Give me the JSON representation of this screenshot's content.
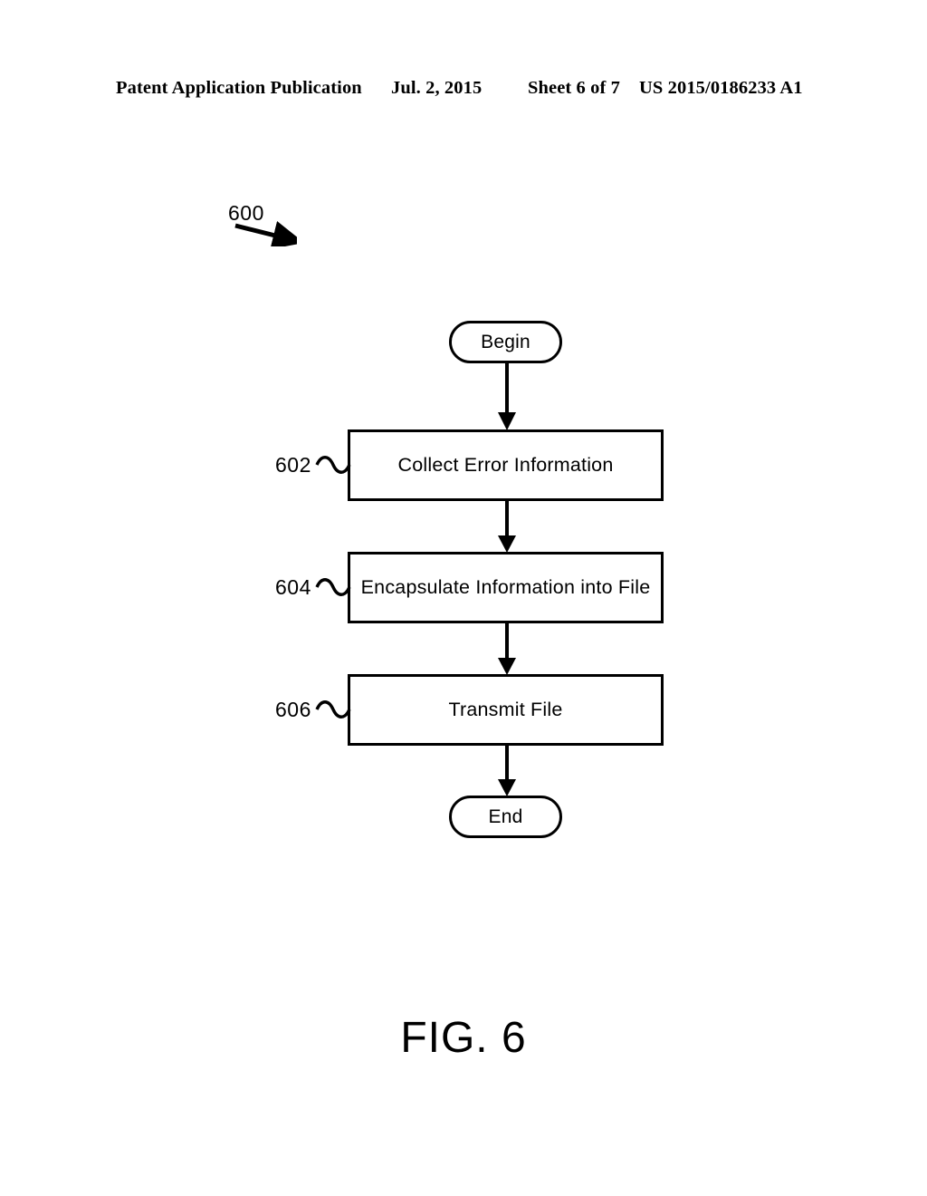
{
  "header": {
    "publication": "Patent Application Publication",
    "date": "Jul. 2, 2015",
    "sheet": "Sheet 6 of 7",
    "patent_number": "US 2015/0186233 A1"
  },
  "figure": {
    "reference_numeral": "600",
    "caption": "FIG. 6"
  },
  "flowchart": {
    "type": "flowchart",
    "nodes": [
      {
        "id": "begin",
        "shape": "terminator",
        "label": "Begin",
        "ref": ""
      },
      {
        "id": "602",
        "shape": "process",
        "label": "Collect Error Information",
        "ref": "602"
      },
      {
        "id": "604",
        "shape": "process",
        "label": "Encapsulate Information into File",
        "ref": "604"
      },
      {
        "id": "606",
        "shape": "process",
        "label": "Transmit File",
        "ref": "606"
      },
      {
        "id": "end",
        "shape": "terminator",
        "label": "End",
        "ref": ""
      }
    ],
    "edges": [
      {
        "from": "begin",
        "to": "602"
      },
      {
        "from": "602",
        "to": "604"
      },
      {
        "from": "604",
        "to": "606"
      },
      {
        "from": "606",
        "to": "end"
      }
    ],
    "stroke_color": "#000000",
    "background_color": "#ffffff"
  }
}
